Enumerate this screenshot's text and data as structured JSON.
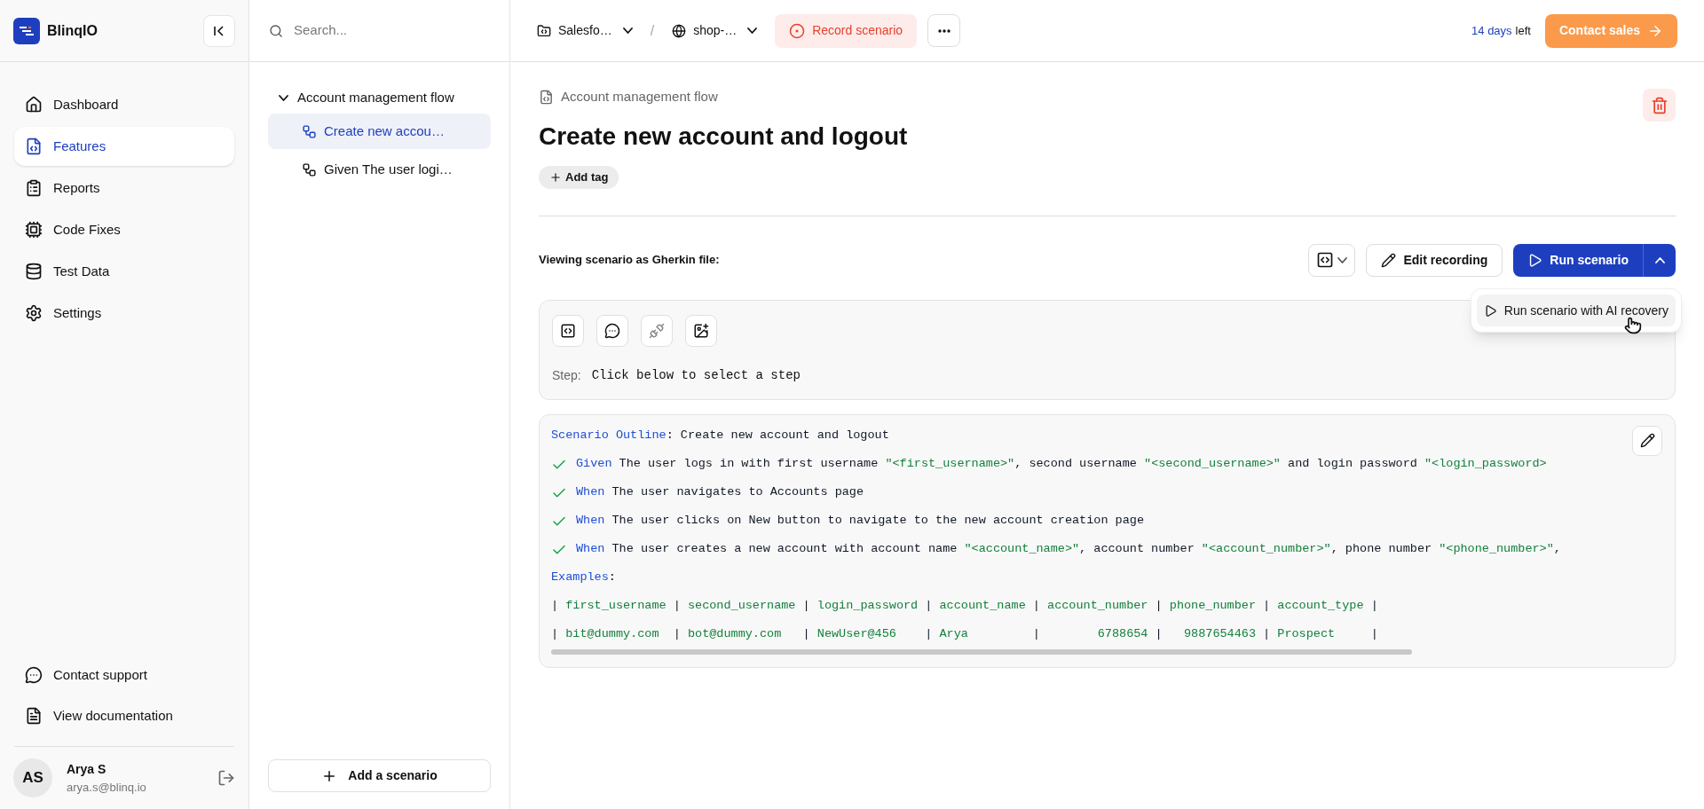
{
  "brand": {
    "name": "BlinqIO"
  },
  "nav": [
    {
      "label": "Dashboard",
      "selected": false
    },
    {
      "label": "Features",
      "selected": true
    },
    {
      "label": "Reports",
      "selected": false
    },
    {
      "label": "Code Fixes",
      "selected": false
    },
    {
      "label": "Test Data",
      "selected": false
    },
    {
      "label": "Settings",
      "selected": false
    }
  ],
  "footer_links": [
    {
      "label": "Contact support"
    },
    {
      "label": "View documentation"
    }
  ],
  "user": {
    "initials": "AS",
    "name": "Arya S",
    "email": "arya.s@blinq.io"
  },
  "scenarios": {
    "search": {
      "placeholder": "Search..."
    },
    "groups": [
      {
        "label": "Account management flow",
        "expanded": true,
        "children": [
          {
            "label": "Create new accou…",
            "selected": true
          },
          {
            "label": "Given The user logi…",
            "selected": false
          }
        ]
      }
    ],
    "add_button": "Add a scenario"
  },
  "topbar": {
    "breadcrumbs": [
      {
        "label": "Salesfo…"
      },
      {
        "label": "shop-…"
      }
    ],
    "separator": "/",
    "record_button": "Record scenario",
    "trial": {
      "days": "14 days",
      "suffix": "left"
    },
    "contact_button": "Contact sales"
  },
  "feature": {
    "parent": "Account management flow",
    "title": "Create new account and logout",
    "add_tag": "Add tag"
  },
  "toolbar": {
    "caption": "Viewing scenario as Gherkin file:",
    "edit_button": "Edit recording",
    "run_button": "Run scenario",
    "run_menu_expanded": true,
    "run_menu": [
      "Run scenario with AI recovery"
    ]
  },
  "step_panel": {
    "label": "Step:",
    "value": "Click below to select a step"
  },
  "code": [
    {
      "check": false,
      "tokens": [
        {
          "kind": "keyword",
          "text": "Scenario Outline"
        },
        {
          "kind": "plain",
          "text": ": Create new account and logout"
        }
      ]
    },
    {
      "check": true,
      "tokens": [
        {
          "kind": "keyword",
          "text": "Given"
        },
        {
          "kind": "plain",
          "text": " The user logs in with first username "
        },
        {
          "kind": "string",
          "text": "\"<first_username>\""
        },
        {
          "kind": "plain",
          "text": ", second username "
        },
        {
          "kind": "string",
          "text": "\"<second_username>\""
        },
        {
          "kind": "plain",
          "text": " and login password "
        },
        {
          "kind": "string",
          "text": "\"<login_password>"
        }
      ]
    },
    {
      "check": true,
      "tokens": [
        {
          "kind": "keyword",
          "text": "When"
        },
        {
          "kind": "plain",
          "text": " The user navigates to Accounts page"
        }
      ]
    },
    {
      "check": true,
      "tokens": [
        {
          "kind": "keyword",
          "text": "When"
        },
        {
          "kind": "plain",
          "text": " The user clicks on New button to navigate to the new account creation page"
        }
      ]
    },
    {
      "check": true,
      "tokens": [
        {
          "kind": "keyword",
          "text": "When"
        },
        {
          "kind": "plain",
          "text": " The user creates a new account with account name "
        },
        {
          "kind": "string",
          "text": "\"<account_name>\""
        },
        {
          "kind": "plain",
          "text": ", account number "
        },
        {
          "kind": "string",
          "text": "\"<account_number>\""
        },
        {
          "kind": "plain",
          "text": ", phone number "
        },
        {
          "kind": "string",
          "text": "\"<phone_number>\""
        },
        {
          "kind": "plain",
          "text": ","
        }
      ]
    },
    {
      "check": false,
      "tokens": [
        {
          "kind": "keyword",
          "text": "Examples"
        },
        {
          "kind": "plain",
          "text": ":"
        }
      ]
    },
    {
      "check": false,
      "tokens": [
        {
          "kind": "plain",
          "text": "| "
        },
        {
          "kind": "string",
          "text": "first_username"
        },
        {
          "kind": "plain",
          "text": " | "
        },
        {
          "kind": "string",
          "text": "second_username"
        },
        {
          "kind": "plain",
          "text": " | "
        },
        {
          "kind": "string",
          "text": "login_password"
        },
        {
          "kind": "plain",
          "text": " | "
        },
        {
          "kind": "string",
          "text": "account_name"
        },
        {
          "kind": "plain",
          "text": " | "
        },
        {
          "kind": "string",
          "text": "account_number"
        },
        {
          "kind": "plain",
          "text": " | "
        },
        {
          "kind": "string",
          "text": "phone_number"
        },
        {
          "kind": "plain",
          "text": " | "
        },
        {
          "kind": "string",
          "text": "account_type"
        },
        {
          "kind": "plain",
          "text": " |"
        }
      ]
    },
    {
      "check": false,
      "tokens": [
        {
          "kind": "plain",
          "text": "| "
        },
        {
          "kind": "string",
          "text": "bit@dummy.com"
        },
        {
          "kind": "plain",
          "text": "  | "
        },
        {
          "kind": "string",
          "text": "bot@dummy.com"
        },
        {
          "kind": "plain",
          "text": "   | "
        },
        {
          "kind": "string",
          "text": "NewUser@456"
        },
        {
          "kind": "plain",
          "text": "    | "
        },
        {
          "kind": "string",
          "text": "Arya"
        },
        {
          "kind": "plain",
          "text": "         |        "
        },
        {
          "kind": "string",
          "text": "6788654"
        },
        {
          "kind": "plain",
          "text": " |   "
        },
        {
          "kind": "string",
          "text": "9887654463"
        },
        {
          "kind": "plain",
          "text": " | "
        },
        {
          "kind": "string",
          "text": "Prospect"
        },
        {
          "kind": "plain",
          "text": "     |"
        }
      ]
    }
  ]
}
